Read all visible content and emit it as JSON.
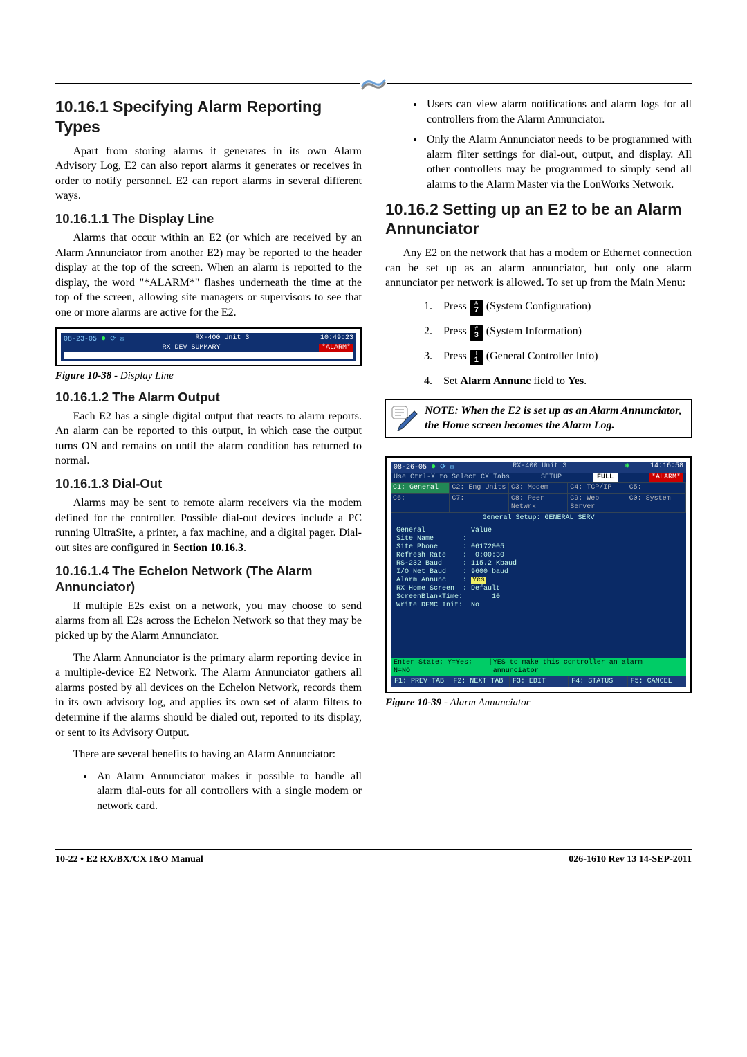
{
  "sections": {
    "s1_title": "10.16.1  Specifying Alarm Reporting Types",
    "s1_p1": "Apart from storing alarms it generates in its own Alarm Advisory Log, E2 can also report alarms it generates or receives in order to notify personnel. E2 can report alarms in several different ways.",
    "s1_1_title": "10.16.1.1  The Display Line",
    "s1_1_p1": " Alarms that occur within an E2 (or which are received by an Alarm Annunciator from another E2) may be reported to the header display at the top of the screen. When an alarm is reported to the display, the word \"*ALARM*\" flashes underneath the time at the top of the screen, allowing site managers or supervisors to see that one or more alarms are active for the E2.",
    "fig38_label": "Figure 10-38",
    "fig38_caption": " - Display Line",
    "s1_2_title": "10.16.1.2  The Alarm Output",
    "s1_2_p1": "Each E2 has a single digital output that reacts to alarm reports. An alarm can be reported to this output, in which case the output turns ON and remains on until the alarm condition has returned to normal.",
    "s1_3_title": "10.16.1.3  Dial-Out",
    "s1_3_p1": "Alarms may be sent to remote alarm receivers via the modem defined for the controller. Possible dial-out devices include a PC running UltraSite, a printer, a fax machine, and a digital pager. Dial-out sites are configured in ",
    "s1_3_bold": "Section 10.16.3",
    "s1_4_title": "10.16.1.4  The Echelon Network (The Alarm Annunciator)",
    "s1_4_p1": "If multiple E2s exist on a network, you may choose to send alarms from all E2s across the Echelon Network so that they may be picked up by the Alarm Annunciator.",
    "s1_4_p2": "The Alarm Annunciator is the primary alarm reporting device in a multiple-device E2 Network. The Alarm Annunciator gathers all alarms posted by all devices on the Echelon Network, records them in its own advisory log, and applies its own set of alarm filters to determine if the alarms should be dialed out, reported to its display, or sent to its Advisory Output.",
    "s1_4_p3": "There are several benefits to having an Alarm Annunciator:",
    "bul1": "An Alarm Annunciator makes it possible to handle all alarm dial-outs for all controllers with a single modem or network card.",
    "bul2": "Users can view alarm notifications and alarm logs for all controllers from the Alarm Annunciator.",
    "bul3": "Only the Alarm Annunciator needs to be programmed with alarm filter settings for dial-out, output, and display. All other controllers may be programmed to simply send all alarms to the Alarm Master via the LonWorks Network.",
    "s2_title": "10.16.2  Setting up an E2 to be an Alarm Annunciator",
    "s2_p1": "Any E2 on the network that has a modem or Ethernet connection can be set up as an alarm annunciator, but only one alarm annunciator per network is allowed. To set up from the Main Menu:",
    "step1a": "Press ",
    "step1b": " (System Configuration)",
    "step2a": "Press ",
    "step2b": " (System Information)",
    "step3a": "Press ",
    "step3b": " (General Controller Info)",
    "step4a": "Set ",
    "step4b": "Alarm Annunc",
    "step4c": " field to ",
    "step4d": "Yes",
    "step4e": ".",
    "note_text": "NOTE: When the E2 is set up as an Alarm Annunciator, the Home screen becomes the Alarm Log.",
    "fig39_label": "Figure 10-39",
    "fig39_caption": " - Alarm Annunciator",
    "footer_left": "10-22 • E2 RX/BX/CX I&O Manual",
    "footer_right": "026-1610 Rev 13 14-SEP-2011"
  },
  "keys": {
    "k7_sym": "&",
    "k7_num": "7",
    "k3_sym": "#",
    "k3_num": "3",
    "k1_sym": "!",
    "k1_num": "1"
  },
  "term1": {
    "date": "08-23-05",
    "title1": "RX-400 Unit 3",
    "title2": "RX DEV SUMMARY",
    "time": "10:49:23",
    "alarm": "*ALARM*"
  },
  "term2": {
    "date": "08-26-05",
    "title": "RX-400 Unit 3",
    "time": "14:16:58",
    "sub_left": "Use Ctrl-X to Select CX Tabs",
    "sub_mid": "SETUP",
    "full": "FULL",
    "alarm": "*ALARM*",
    "tabs": [
      "C1: General",
      "C2: Eng Units",
      "C3: Modem",
      "C4: TCP/IP",
      "C5:",
      "C6:",
      "C7:",
      "C8: Peer Netwrk",
      "C9: Web Server",
      "C0: System"
    ],
    "section": "General Setup: GENERAL SERV",
    "rows": [
      "General           Value",
      "Site Name       :",
      "Site Phone      : 06172005",
      "Refresh Rate    :  0:00:30",
      "RS-232 Baud     : 115.2 Kbaud",
      "I/O Net Baud    : 9600 baud",
      "Alarm Annunc    : ",
      "RX Home Screen  : Default",
      "ScreenBlankTime:       10",
      "Write DFMC Init:  No"
    ],
    "yes": "Yes",
    "status_left": "Enter State:  Y=Yes;  N=NO",
    "status_right": "YES to make this controller an alarm annunciator",
    "fkeys": [
      "F1: PREV TAB",
      "F2: NEXT TAB",
      "F3: EDIT",
      "F4: STATUS",
      "F5: CANCEL"
    ]
  }
}
